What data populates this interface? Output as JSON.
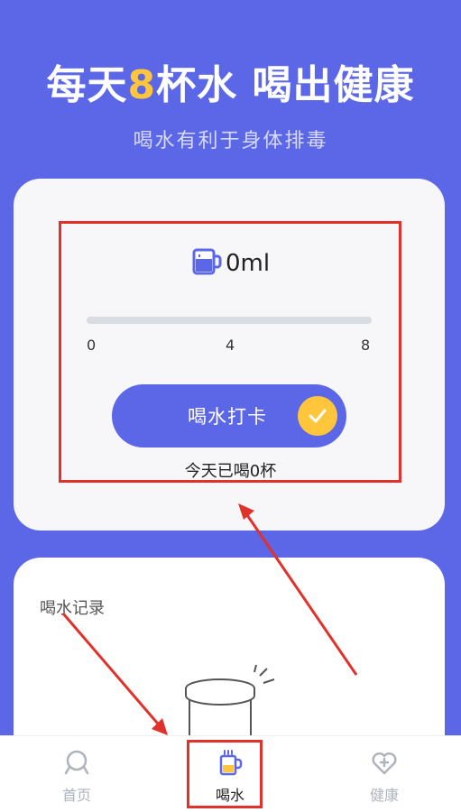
{
  "header": {
    "title_prefix": "每天",
    "title_number": "8",
    "title_suffix": "杯水 喝出健康",
    "subtitle": "喝水有利于身体排毒"
  },
  "tracker": {
    "amount": "0ml",
    "progress_fraction": 0,
    "ticks": [
      "0",
      "4",
      "8"
    ],
    "button_label": "喝水打卡",
    "today_status": "今天已喝0杯"
  },
  "record": {
    "title": "喝水记录"
  },
  "tabbar": {
    "items": [
      {
        "label": "首页",
        "icon": "home-icon"
      },
      {
        "label": "喝水",
        "icon": "cup-icon"
      },
      {
        "label": "健康",
        "icon": "heart-plus-icon"
      }
    ]
  },
  "colors": {
    "primary": "#5b67e6",
    "accent": "#ffc63c",
    "annotation": "#e0322b"
  }
}
